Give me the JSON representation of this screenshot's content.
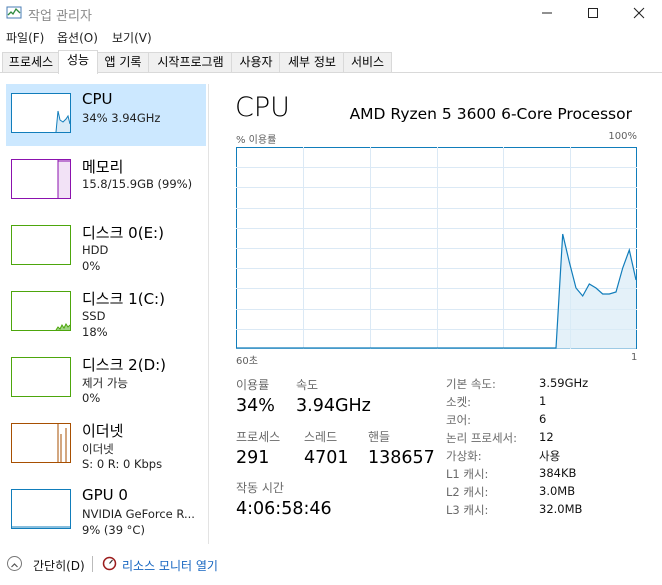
{
  "window": {
    "title": "작업 관리자"
  },
  "menu": [
    {
      "label": "파일(F)"
    },
    {
      "label": "옵션(O)"
    },
    {
      "label": "보기(V)"
    }
  ],
  "tabs": [
    {
      "label": "프로세스"
    },
    {
      "label": "성능"
    },
    {
      "label": "앱 기록"
    },
    {
      "label": "시작프로그램"
    },
    {
      "label": "사용자"
    },
    {
      "label": "세부 정보"
    },
    {
      "label": "서비스"
    }
  ],
  "active_tab": "성능",
  "devices": [
    {
      "name": "CPU",
      "line2": "34% 3.94GHz",
      "line3": "",
      "color": "#117dbb",
      "selected": true
    },
    {
      "name": "메모리",
      "line2": "15.8/15.9GB (99%)",
      "line3": "",
      "color": "#8b12ae",
      "selected": false
    },
    {
      "name": "디스크 0(E:)",
      "line2": "HDD",
      "line3": "0%",
      "color": "#4da60c",
      "selected": false
    },
    {
      "name": "디스크 1(C:)",
      "line2": "SSD",
      "line3": "18%",
      "color": "#4da60c",
      "selected": false
    },
    {
      "name": "디스크 2(D:)",
      "line2": "제거 가능",
      "line3": "0%",
      "color": "#4da60c",
      "selected": false
    },
    {
      "name": "이더넷",
      "line2": "이더넷",
      "line3": "S: 0 R: 0 Kbps",
      "color": "#a74f01",
      "selected": false
    },
    {
      "name": "GPU 0",
      "line2": "NVIDIA GeForce R...",
      "line3": "9% (39 °C)",
      "color": "#117dbb",
      "selected": false
    }
  ],
  "detail": {
    "title": "CPU",
    "model": "AMD Ryzen 5 3600 6-Core Processor",
    "y_label": "% 이용률",
    "y_max_label": "100%",
    "x_left_label": "60초",
    "x_right_label": "1",
    "graph_color": "#117dbb",
    "utilization_history": [
      0,
      0,
      0,
      0,
      0,
      0,
      0,
      0,
      0,
      0,
      0,
      0,
      0,
      0,
      0,
      0,
      0,
      0,
      0,
      0,
      0,
      0,
      0,
      0,
      0,
      0,
      0,
      0,
      0,
      0,
      0,
      0,
      0,
      0,
      0,
      0,
      0,
      0,
      0,
      0,
      0,
      0,
      0,
      0,
      0,
      0,
      0,
      0,
      0,
      57,
      43,
      30,
      26,
      32,
      30,
      27,
      27,
      28,
      40,
      49,
      34
    ]
  },
  "stats": {
    "utilization": {
      "label": "이용률",
      "value": "34%"
    },
    "speed": {
      "label": "속도",
      "value": "3.94GHz"
    },
    "processes": {
      "label": "프로세스",
      "value": "291"
    },
    "threads": {
      "label": "스레드",
      "value": "4701"
    },
    "handles": {
      "label": "핸들",
      "value": "138657"
    },
    "uptime": {
      "label": "작동 시간",
      "value": "4:06:58:46"
    }
  },
  "specs": [
    {
      "label": "기본 속도:",
      "value": "3.59GHz"
    },
    {
      "label": "소켓:",
      "value": "1"
    },
    {
      "label": "코어:",
      "value": "6"
    },
    {
      "label": "논리 프로세서:",
      "value": "12"
    },
    {
      "label": "가상화:",
      "value": "사용"
    },
    {
      "label": "L1 캐시:",
      "value": "384KB"
    },
    {
      "label": "L2 캐시:",
      "value": "3.0MB"
    },
    {
      "label": "L3 캐시:",
      "value": "32.0MB"
    }
  ],
  "footer": {
    "fewer_details": "간단히(D)",
    "resource_monitor": "리소스 모니터 열기"
  }
}
